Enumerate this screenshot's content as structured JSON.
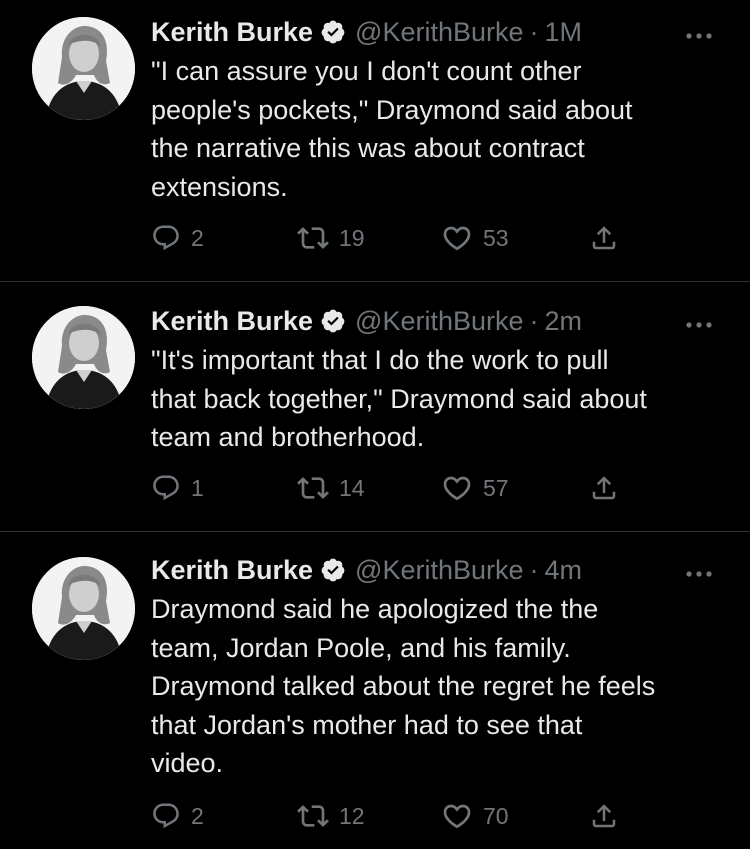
{
  "tweets": [
    {
      "author_name": "Kerith Burke",
      "handle": "@KerithBurke",
      "separator": "·",
      "time": "1M",
      "lines": [
        "\"I can assure you I don't count other",
        "people's pockets,\" Draymond said about",
        "the narrative this was about contract",
        "extensions."
      ],
      "replies": "2",
      "retweets": "19",
      "likes": "53"
    },
    {
      "author_name": "Kerith Burke",
      "handle": "@KerithBurke",
      "separator": "·",
      "time": "2m",
      "lines": [
        "\"It's important that I do the work to pull",
        "that back together,\" Draymond said about",
        "team and brotherhood."
      ],
      "replies": "1",
      "retweets": "14",
      "likes": "57"
    },
    {
      "author_name": "Kerith Burke",
      "handle": "@KerithBurke",
      "separator": "·",
      "time": "4m",
      "lines": [
        "Draymond said he apologized the the",
        "team, Jordan Poole, and his family.",
        "Draymond talked about the regret he feels",
        "that Jordan's mother had to see that",
        "video."
      ],
      "replies": "2",
      "retweets": "12",
      "likes": "70"
    }
  ],
  "icons": {
    "verified": "verified-badge-icon",
    "more": "more-dots-icon",
    "reply": "reply-icon",
    "retweet": "retweet-icon",
    "like": "heart-icon",
    "share": "share-icon"
  },
  "colors": {
    "background": "#000000",
    "text": "#e7e9ea",
    "secondary": "#71767b",
    "divider": "#2f3336"
  }
}
